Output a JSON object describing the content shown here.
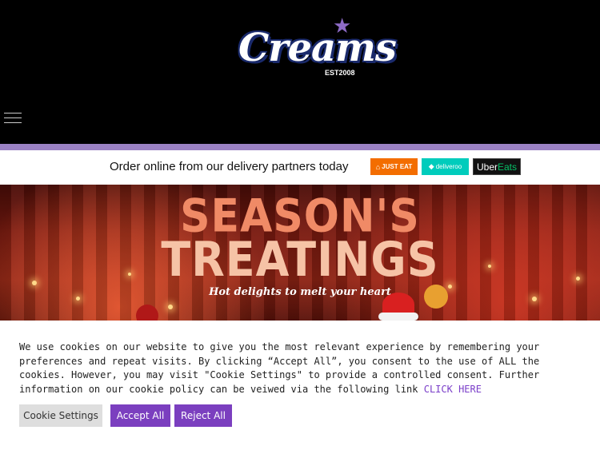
{
  "header": {
    "logo_text": "Creams",
    "logo_est": "EST2008",
    "menu_icon": "hamburger-menu-icon"
  },
  "delivery_bar": {
    "text": "Order online from our delivery partners today",
    "partners": [
      {
        "name": "JUST EAT",
        "icon": "house-icon",
        "color": "#f36d00"
      },
      {
        "name": "deliveroo",
        "icon": "kangaroo-icon",
        "color": "#00ccbc"
      },
      {
        "name_uber": "Uber",
        "name_eats": "Eats",
        "color": "#111111"
      }
    ]
  },
  "hero": {
    "title_line1": "SEASON'S",
    "title_line2": "TREATINGS",
    "tagline": "Hot delights to melt your heart"
  },
  "cookie_notice": {
    "text": "We use cookies on our website to give you the most relevant experience by remembering your preferences and repeat visits. By clicking “Accept All”, you consent to the use of ALL the cookies. However, you may visit \"Cookie Settings\" to provide a controlled consent. Further information on our cookie policy can be veiwed via the following link",
    "link_text": "CLICK HERE",
    "buttons": {
      "settings": "Cookie Settings",
      "accept": "Accept All",
      "reject": "Reject All"
    }
  },
  "colors": {
    "brand_purple": "#9b82c4",
    "button_purple": "#7b3fbf",
    "header_bg": "#000000"
  }
}
